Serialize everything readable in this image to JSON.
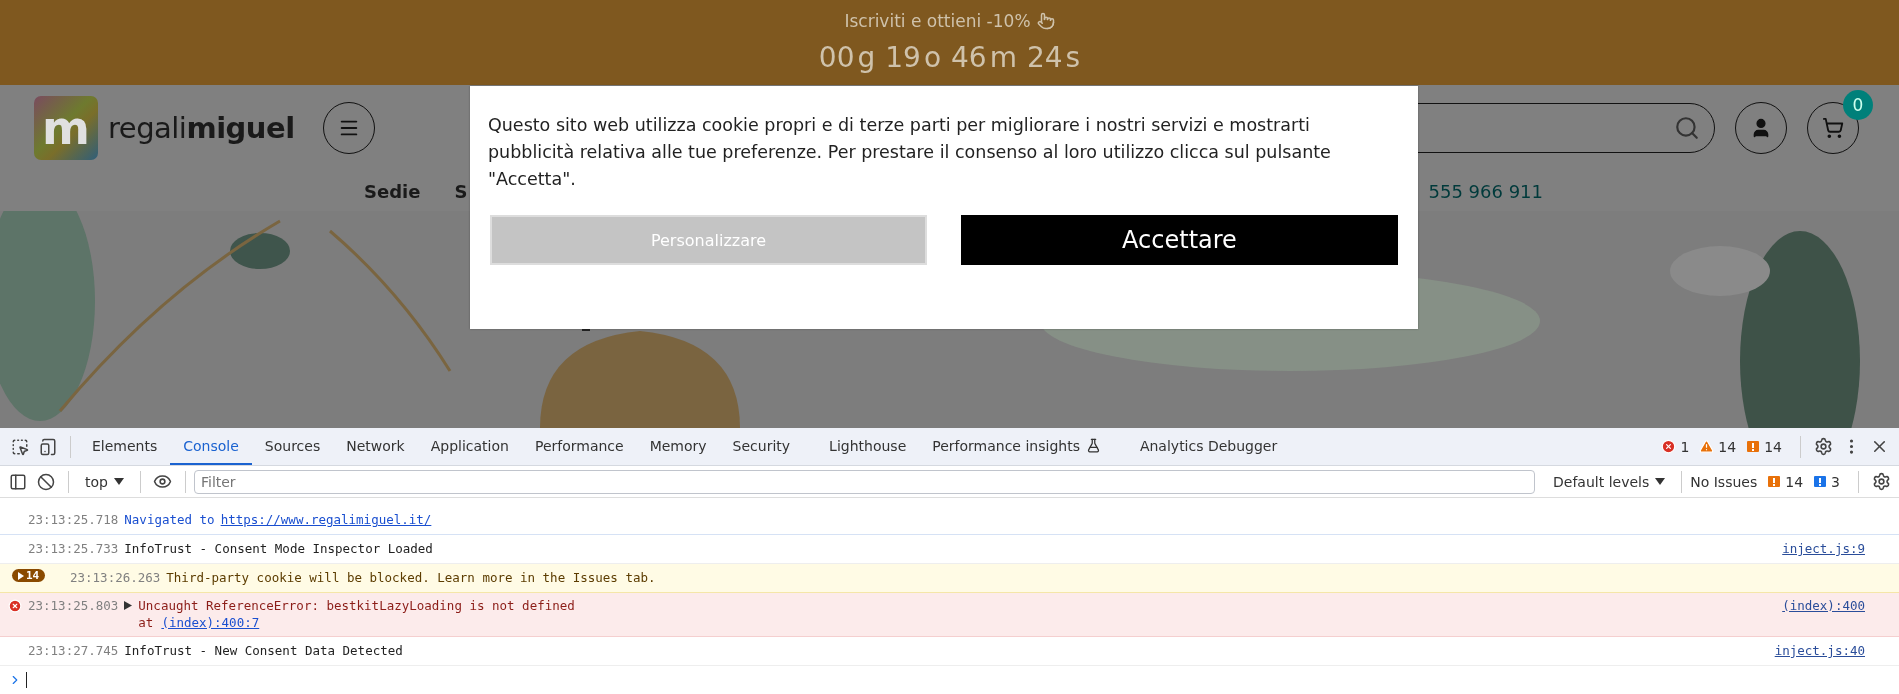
{
  "promo_banner": {
    "text": "Iscriviti e ottieni -10%",
    "countdown": [
      {
        "value": "00",
        "unit": "g"
      },
      {
        "value": "19",
        "unit": "o"
      },
      {
        "value": "46",
        "unit": "m"
      },
      {
        "value": "24",
        "unit": "s"
      }
    ]
  },
  "header": {
    "logo": {
      "mark": "m",
      "name_light": "regali",
      "name_bold": "miguel"
    },
    "cart_count": "0",
    "nav": [
      {
        "label": "Sedie"
      },
      {
        "label": "S"
      }
    ],
    "phone": "555 966 911"
  },
  "cookie_dialog": {
    "message": "Questo sito web utilizza cookie propri e di terze parti per migliorare i nostri servizi e mostrarti pubblicità relativa alle tue preferenze. Per prestare il consenso al loro utilizzo clicca sul pulsante \"Accetta\".",
    "buttons": [
      {
        "label": "Personalizzare",
        "kind": "secondary"
      },
      {
        "label": "Accettare",
        "kind": "primary"
      }
    ]
  },
  "devtools": {
    "tabs": [
      {
        "label": "Elements",
        "selected": false,
        "kind": "plain"
      },
      {
        "label": "Console",
        "selected": true,
        "kind": "plain"
      },
      {
        "label": "Sources",
        "selected": false,
        "kind": "plain"
      },
      {
        "label": "Network",
        "selected": false,
        "kind": "plain"
      },
      {
        "label": "Application",
        "selected": false,
        "kind": "plain"
      },
      {
        "label": "Performance",
        "selected": false,
        "kind": "plain"
      },
      {
        "label": "Memory",
        "selected": false,
        "kind": "plain"
      },
      {
        "label": "Security",
        "selected": false,
        "kind": "plain"
      },
      {
        "label": "Lighthouse",
        "selected": false,
        "kind": "plain"
      },
      {
        "label": "Performance insights",
        "selected": false,
        "kind": "experimental"
      },
      {
        "label": "Analytics Debugger",
        "selected": false,
        "kind": "plain"
      }
    ],
    "counts": {
      "errors": "1",
      "warnings": "14",
      "issues": "14"
    },
    "toolbar": {
      "context": "top",
      "filter_placeholder": "Filter",
      "levels": "Default levels",
      "issues_label": "No Issues",
      "issue_counts": [
        {
          "kind": "warning",
          "count": "14"
        },
        {
          "kind": "info",
          "count": "3"
        }
      ]
    },
    "console": [
      {
        "kind": "navigation",
        "time": "23:13:25.718",
        "message": "Navigated to",
        "link": "https://www.regalimiguel.it/"
      },
      {
        "kind": "log",
        "time": "23:13:25.733",
        "message": "InfoTrust - Consent Mode Inspector Loaded",
        "source": "inject.js:9"
      },
      {
        "kind": "warning",
        "repeat_count": "14",
        "time": "23:13:26.263",
        "message": "Third-party cookie will be blocked. Learn more in the Issues tab."
      },
      {
        "kind": "error",
        "time": "23:13:25.803",
        "message": "Uncaught ReferenceError: bestkitLazyLoading is not defined",
        "stack_prefix": "at",
        "stack_link": "(index):400:7",
        "source": "(index):400"
      },
      {
        "kind": "log",
        "time": "23:13:27.745",
        "message": "InfoTrust - New Consent Data Detected",
        "source": "inject.js:40"
      }
    ]
  }
}
